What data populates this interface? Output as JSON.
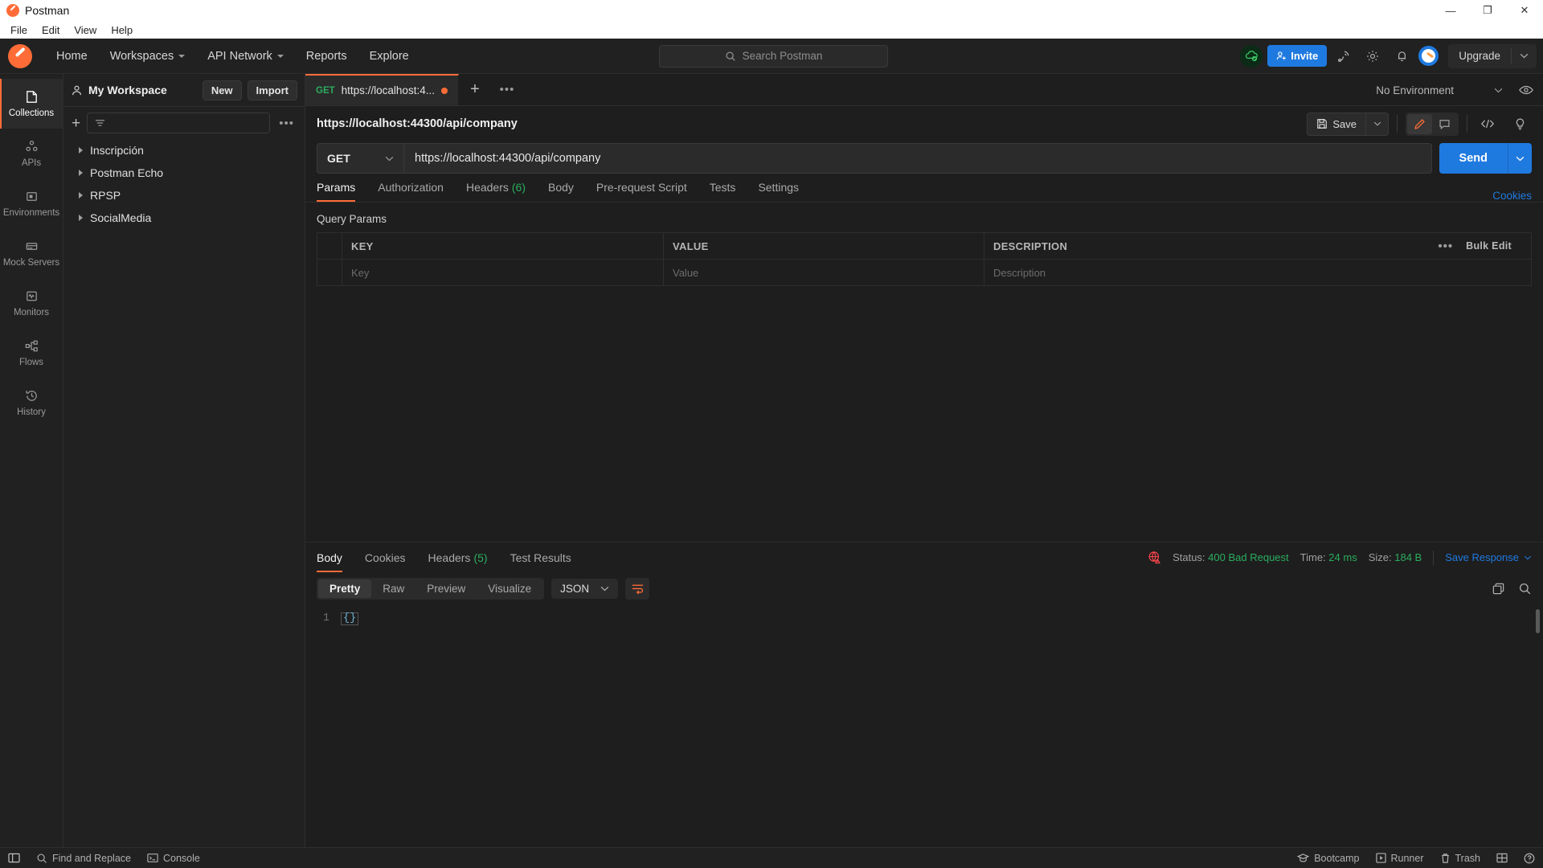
{
  "window": {
    "title": "Postman",
    "menu": [
      "File",
      "Edit",
      "View",
      "Help"
    ],
    "controls": {
      "minimize": "—",
      "maximize": "❐",
      "close": "✕"
    }
  },
  "topnav": {
    "items": [
      {
        "label": "Home",
        "caret": false
      },
      {
        "label": "Workspaces",
        "caret": true
      },
      {
        "label": "API Network",
        "caret": true
      },
      {
        "label": "Reports",
        "caret": false
      },
      {
        "label": "Explore",
        "caret": false
      }
    ],
    "search_placeholder": "Search Postman",
    "invite_label": "Invite",
    "upgrade_label": "Upgrade"
  },
  "rail": {
    "items": [
      {
        "label": "Collections",
        "icon": "collections-icon",
        "active": true
      },
      {
        "label": "APIs",
        "icon": "apis-icon",
        "active": false
      },
      {
        "label": "Environments",
        "icon": "environments-icon",
        "active": false
      },
      {
        "label": "Mock Servers",
        "icon": "mock-servers-icon",
        "active": false
      },
      {
        "label": "Monitors",
        "icon": "monitors-icon",
        "active": false
      },
      {
        "label": "Flows",
        "icon": "flows-icon",
        "active": false
      },
      {
        "label": "History",
        "icon": "history-icon",
        "active": false
      }
    ]
  },
  "sidebar": {
    "workspace_name": "My Workspace",
    "new_label": "New",
    "import_label": "Import",
    "filter_placeholder": "",
    "collections": [
      {
        "name": "Inscripción"
      },
      {
        "name": "Postman Echo"
      },
      {
        "name": "RPSP"
      },
      {
        "name": "SocialMedia"
      }
    ]
  },
  "tabbar": {
    "tabs": [
      {
        "method": "GET",
        "label": "https://localhost:4...",
        "unsaved": true,
        "active": true
      }
    ],
    "environment": "No Environment"
  },
  "request": {
    "title": "https://localhost:44300/api/company",
    "save_label": "Save",
    "method": "GET",
    "url": "https://localhost:44300/api/company",
    "send_label": "Send",
    "tabs": [
      {
        "label": "Params",
        "count": "",
        "active": true
      },
      {
        "label": "Authorization",
        "count": "",
        "active": false
      },
      {
        "label": "Headers",
        "count": "(6)",
        "active": false
      },
      {
        "label": "Body",
        "count": "",
        "active": false
      },
      {
        "label": "Pre-request Script",
        "count": "",
        "active": false
      },
      {
        "label": "Tests",
        "count": "",
        "active": false
      },
      {
        "label": "Settings",
        "count": "",
        "active": false
      }
    ],
    "cookies_link": "Cookies",
    "query_params": {
      "section_label": "Query Params",
      "headers": [
        "KEY",
        "VALUE",
        "DESCRIPTION"
      ],
      "bulk_edit_label": "Bulk Edit",
      "empty_row": {
        "key": "Key",
        "value": "Value",
        "description": "Description"
      }
    }
  },
  "response": {
    "tabs": [
      {
        "label": "Body",
        "count": "",
        "active": true
      },
      {
        "label": "Cookies",
        "count": "",
        "active": false
      },
      {
        "label": "Headers",
        "count": "(5)",
        "active": false
      },
      {
        "label": "Test Results",
        "count": "",
        "active": false
      }
    ],
    "status_label": "Status:",
    "status_value": "400 Bad Request",
    "time_label": "Time:",
    "time_value": "24 ms",
    "size_label": "Size:",
    "size_value": "184 B",
    "save_response_label": "Save Response",
    "formats": [
      {
        "label": "Pretty",
        "active": true
      },
      {
        "label": "Raw",
        "active": false
      },
      {
        "label": "Preview",
        "active": false
      },
      {
        "label": "Visualize",
        "active": false
      }
    ],
    "language": "JSON",
    "body_lines": [
      {
        "number": "1",
        "text": "{}"
      }
    ]
  },
  "bottombar": {
    "left": [
      {
        "label": "Find and Replace",
        "icon": "search-icon"
      },
      {
        "label": "Console",
        "icon": "console-icon"
      }
    ],
    "right": [
      {
        "label": "Bootcamp",
        "icon": "graduation-cap-icon"
      },
      {
        "label": "Runner",
        "icon": "play-icon"
      },
      {
        "label": "Trash",
        "icon": "trash-icon"
      }
    ]
  },
  "colors": {
    "accent": "#ff6c37",
    "blue": "#1f7ae0",
    "green": "#2bad5f",
    "bg": "#1e1e1e",
    "panel": "#212121"
  }
}
